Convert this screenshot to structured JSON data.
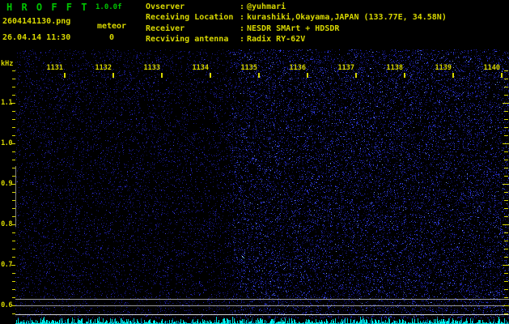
{
  "app": {
    "title": "H R O F F T",
    "version": "1.0.0f"
  },
  "file": {
    "name": "2604141130.png",
    "datetime": "26.04.14 11:30"
  },
  "meteor": {
    "label": "meteor",
    "count": "0"
  },
  "observer_info": {
    "separator": ":",
    "rows": [
      {
        "label": "Ovserver",
        "value": "@yuhmari"
      },
      {
        "label": "Receiving Location",
        "value": "kurashiki,Okayama,JAPAN (133.77E, 34.58N)"
      },
      {
        "label": "Receiver",
        "value": "NESDR SMArt + HDSDR"
      },
      {
        "label": "Recviving antenna",
        "value": "Radix RY-62V"
      }
    ]
  },
  "chart_data": {
    "type": "heatmap",
    "subtype": "radio-meteor-spectrogram",
    "title": "HROFFT 10-minute spectrogram 11:30-11:40",
    "ylabel": "kHz",
    "y_unit_label": "kHz",
    "y_tick_labels": [
      "1.1",
      "1.0",
      "0.9",
      "0.8",
      "0.7",
      "0.6"
    ],
    "y_tick_values_khz": [
      1.1,
      1.0,
      0.9,
      0.8,
      0.7,
      0.6
    ],
    "y_minor_step_khz": 0.02,
    "y_range_khz": [
      0.578,
      1.232
    ],
    "x_tick_labels": [
      "1131",
      "1132",
      "1133",
      "1134",
      "1135",
      "1136",
      "1137",
      "1138",
      "1139",
      "1140"
    ],
    "x_tick_values_min": [
      1131,
      1132,
      1133,
      1134,
      1135,
      1136,
      1137,
      1138,
      1139,
      1140
    ],
    "x_range_min": [
      1129.98,
      1140.15
    ],
    "grid": false,
    "legend": "none",
    "background": "black with sparse dark-blue noise speckles",
    "noise": {
      "seam_minute": 1134.45,
      "left_density": 0.085,
      "right_density": 0.15,
      "description": "right segment (after ~11:34.5) noticeably denser/brighter blue noise"
    },
    "marker_lines": [
      {
        "freq_khz": 0.616,
        "color": "#9a9a9a"
      },
      {
        "freq_khz": 0.6,
        "color": "#9a9a9a"
      },
      {
        "freq_khz": 0.578,
        "color": "#d2d2d2"
      }
    ],
    "left_edge_bar_khz": [
      0.794,
      0.944
    ],
    "features": [
      {
        "minute": 1134.7,
        "freq_khz": 0.72,
        "type": "faint-echo-streak",
        "color": "#aef6ff"
      }
    ],
    "signal_strip": {
      "description": "cyan jagged signal-level trace along bottom edge",
      "color": "#00d8d8"
    },
    "colors": {
      "axis_text": "#d8d800",
      "title_green": "#00c400",
      "noise_blue": "#2020c8",
      "strip_cyan": "#00e0e0",
      "marker_gray": "#aaaaaa"
    },
    "meteor_count": 0
  }
}
